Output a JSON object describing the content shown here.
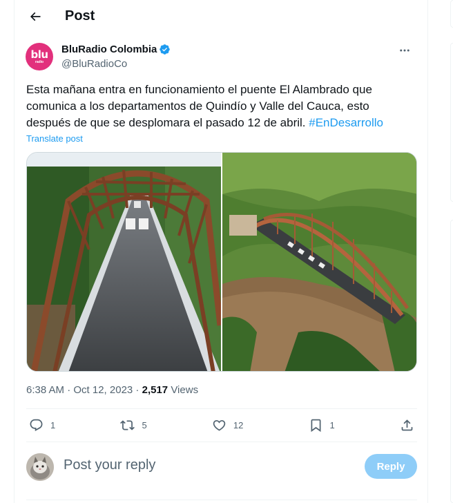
{
  "header": {
    "title": "Post",
    "back_icon": "arrow-left-icon"
  },
  "tweet": {
    "author": {
      "display_name": "BluRadio Colombia",
      "handle": "@BluRadioCo",
      "avatar_text": "blu",
      "avatar_subtext": "radio",
      "verified": true
    },
    "text": "Esta mañana entra en funcionamiento el puente El Alambrado que comunica a los departamentos de Quindío y Valle del Cauca, esto después de que se desplomara el pasado 12 de abril.",
    "hashtag": "#EnDesarrollo",
    "translate_label": "Translate post",
    "timestamp": "6:38 AM · Oct 12, 2023",
    "separator": " · ",
    "views_count": "2,517",
    "views_label": "Views",
    "actions": {
      "replies": "1",
      "reposts": "5",
      "likes": "12",
      "bookmarks": "1"
    }
  },
  "reply_box": {
    "placeholder": "Post your reply",
    "button_label": "Reply"
  },
  "colors": {
    "accent": "#1d9bf0",
    "reply_button_disabled": "#8ecdf8",
    "secondary_text": "#536471",
    "brand_avatar": "#e2307c"
  }
}
